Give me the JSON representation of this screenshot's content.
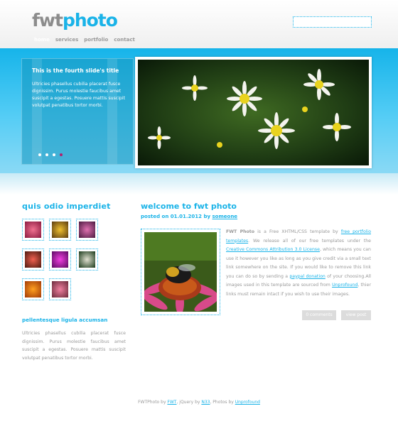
{
  "logo": {
    "part1": "fwt",
    "part2": "photo"
  },
  "nav": [
    {
      "label": "home",
      "active": true
    },
    {
      "label": "services",
      "active": false
    },
    {
      "label": "portfolio",
      "active": false
    },
    {
      "label": "contact",
      "active": false
    }
  ],
  "search": {
    "placeholder": ""
  },
  "slider": {
    "title": "This is the fourth slide's title",
    "text": "Ultricies phasellus cubilia placerat fusce dignissim. Purus molestie faucibus amet suscipit a egestas. Posuere mattis suscipit volutpat penatibus tortor morbi.",
    "dots": 4,
    "active_dot": 4
  },
  "sidebar": {
    "heading": "quis odio imperdiet",
    "subheading": "pellentesque ligula accumsan",
    "text": "Ultricies phasellus cubilia placerat fusce dignissim. Purus molestie faucibus amet suscipit a egestas. Posuere mattis suscipit volutpat penatibus tortor morbi.",
    "thumb_colors": [
      "#c0306a",
      "#d08a1a",
      "#b4508a",
      "#c03a30",
      "#c024b0",
      "#2a6a2a",
      "#e06a10",
      "#d05078"
    ]
  },
  "post": {
    "heading": "welcome to fwt photo",
    "posted_prefix": "posted on 01.01.2012 by",
    "author": "someone",
    "brand": "FWT Photo",
    "t1": " is a Free XHTML/CSS template by ",
    "link1": "free portfolio templates",
    "t2": ". We release all of our free templates under the ",
    "link2": "Creative Commons Attribution 3.0 License",
    "t3": ", which means you can use it however you like as long as you give credit via a small text link somewhere on the site. If you would like to remove this link you can do so by sending a ",
    "link3": "paypal donation",
    "t4": " of your choosing.All images used in this template are sourced from ",
    "link4": "Unprofound",
    "t5": ", thier links must remain intact if you wish to use their images.",
    "comments_button": "0 comments",
    "view_button": "view post"
  },
  "footer": {
    "t1": "FWTPhoto by ",
    "link1": "FWT",
    "t2": ", jQuery by ",
    "link2": "N33",
    "t3": ", Photos by ",
    "link3": "Unprofound"
  },
  "colors": {
    "accent": "#1ab3e8",
    "text": "#9a9a9a",
    "active_dot": "#b0206e"
  }
}
